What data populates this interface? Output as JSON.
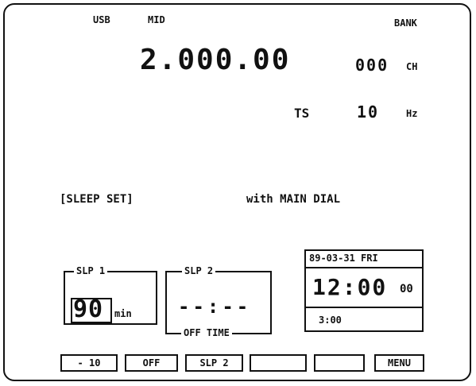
{
  "status": {
    "mode": "USB",
    "agc": "MID",
    "bank": "BANK"
  },
  "frequency": {
    "value": "2.000.00",
    "channel_digits": "000",
    "channel_unit": "CH"
  },
  "tuning_step": {
    "label": "TS",
    "value": "10",
    "unit": "Hz"
  },
  "message": {
    "title": "[SLEEP SET]",
    "hint": "with MAIN DIAL"
  },
  "slp1": {
    "label": "SLP 1",
    "value": "90",
    "unit": "min"
  },
  "slp2": {
    "label": "SLP 2",
    "value": "--:--",
    "sublabel": "OFF TIME"
  },
  "clock": {
    "date": "89-03-31 FRI",
    "time": "12:00",
    "seconds": "00",
    "sub_time": "3:00"
  },
  "softkeys": [
    "- 10",
    "OFF",
    "SLP 2",
    "",
    "",
    "MENU"
  ]
}
